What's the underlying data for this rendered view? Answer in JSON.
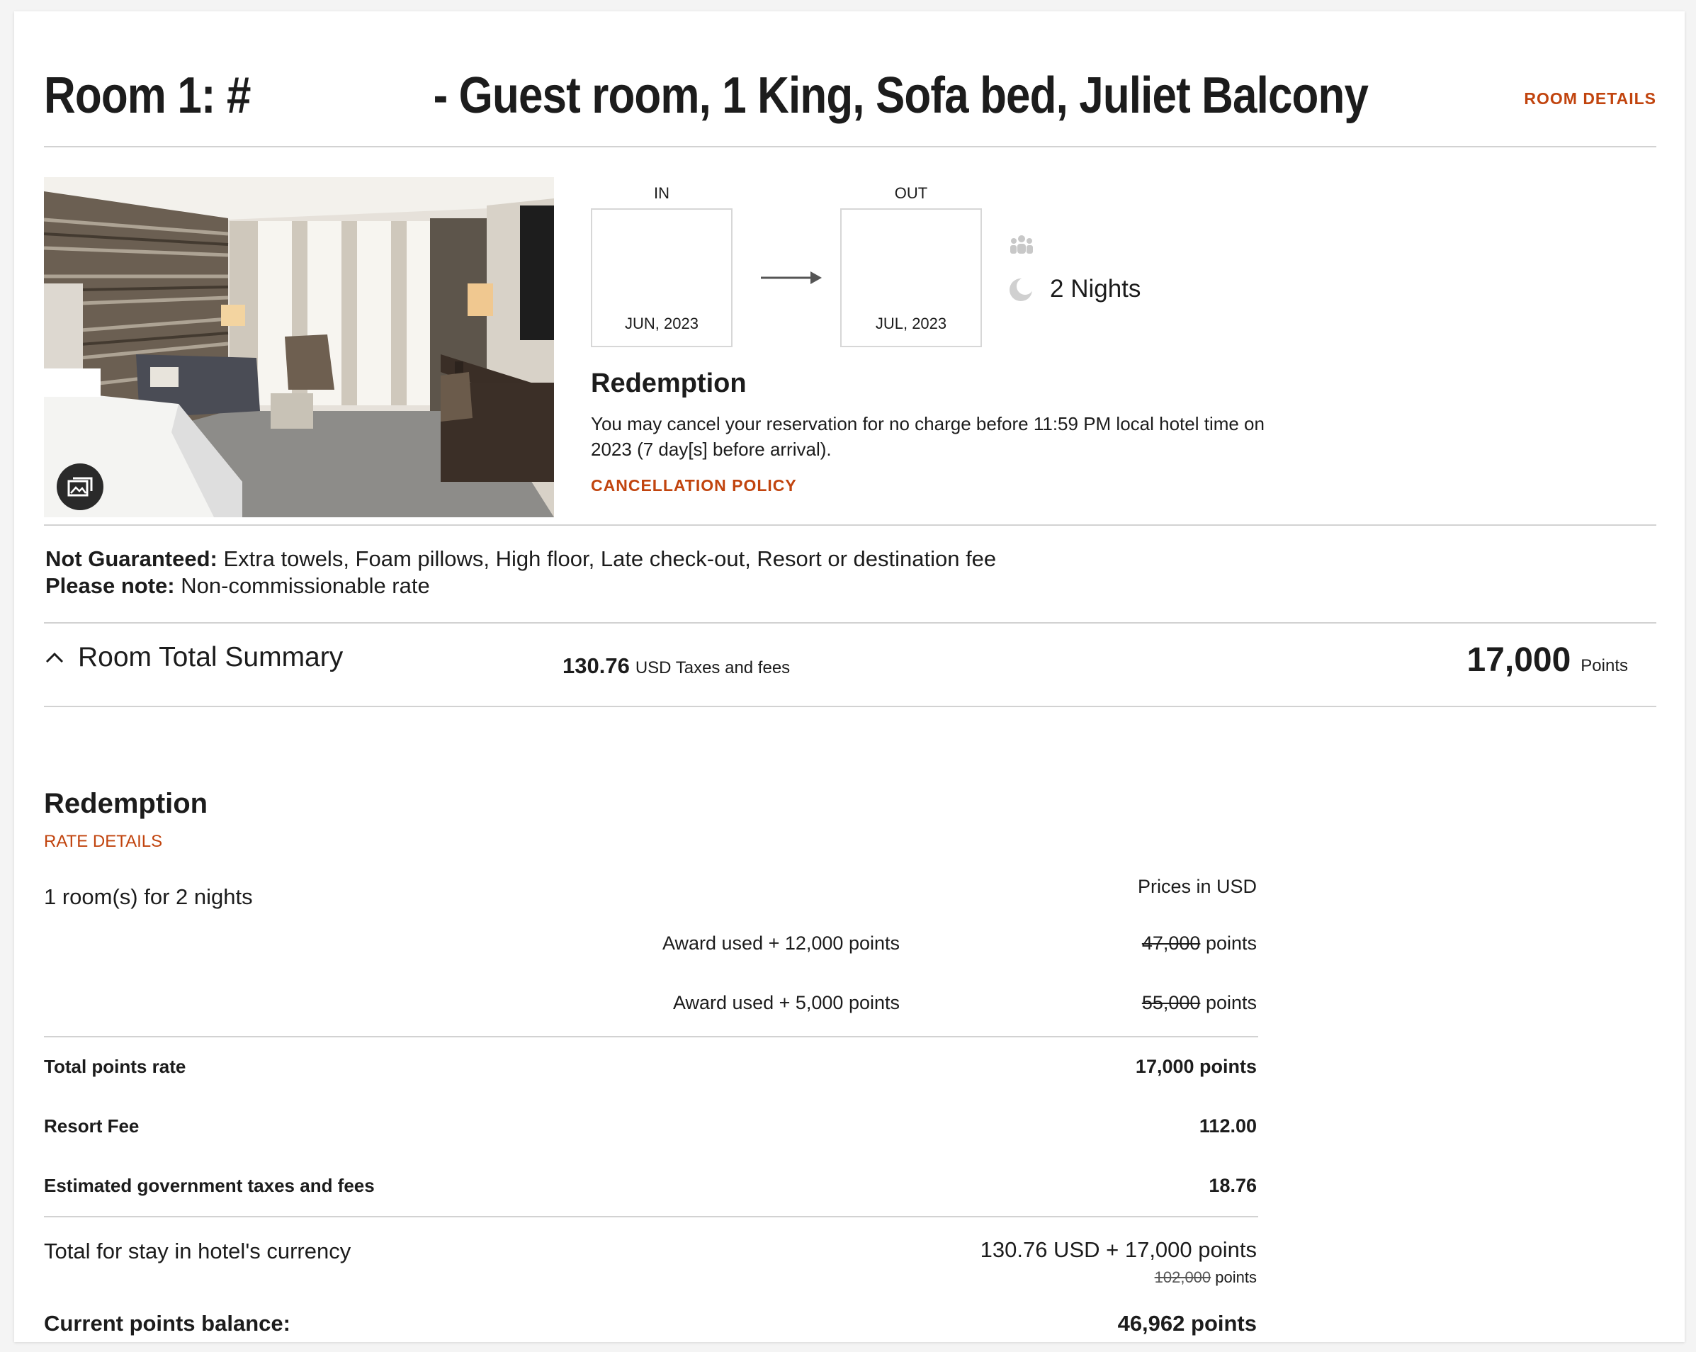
{
  "room": {
    "title_prefix": "Room 1: #",
    "title_suffix": "- Guest room, 1 King, Sofa bed, Juliet Balcony",
    "details_link": "ROOM DETAILS"
  },
  "stay": {
    "in_label": "IN",
    "in_month": "JUN, 2023",
    "out_label": "OUT",
    "out_month": "JUL, 2023",
    "nights": "2 Nights"
  },
  "redemption_info": {
    "heading": "Redemption",
    "line1": "You may cancel your reservation for no charge before 11:59 PM local hotel time on",
    "line2": "2023 (7 day[s] before arrival).",
    "policy_link": "CANCELLATION POLICY"
  },
  "notes": {
    "not_guaranteed_label": "Not Guaranteed:",
    "not_guaranteed_value": "Extra towels, Foam pillows, High floor, Late check-out, Resort or destination fee",
    "please_note_label": "Please note:",
    "please_note_value": "Non-commissionable rate"
  },
  "summary": {
    "title": "Room Total Summary",
    "taxes_amount": "130.76",
    "taxes_label": "USD Taxes and fees",
    "points_amount": "17,000",
    "points_label": "Points"
  },
  "rate": {
    "heading": "Redemption",
    "details_link": "RATE DETAILS",
    "rooms_nights": "1 room(s) for 2 nights",
    "prices_in": "Prices in USD",
    "nightly": [
      {
        "award": "Award used + 12,000 points",
        "original": "47,000",
        "unit": "points"
      },
      {
        "award": "Award used + 5,000 points",
        "original": "55,000",
        "unit": "points"
      }
    ],
    "total_points_label": "Total points rate",
    "total_points_value": "17,000 points",
    "resort_fee_label": "Resort Fee",
    "resort_fee_value": "112.00",
    "gov_tax_label": "Estimated government taxes and fees",
    "gov_tax_value": "18.76",
    "total_stay_label": "Total for stay in hotel's currency",
    "total_stay_value": "130.76 USD + 17,000 points",
    "total_stay_original": "102,000",
    "total_stay_original_unit": "points",
    "balance_label": "Current points balance:",
    "balance_value": "46,962 points"
  },
  "colors": {
    "accent": "#c1440e",
    "divider": "#d2d2d2",
    "icon_gray": "#c8c8c8"
  }
}
